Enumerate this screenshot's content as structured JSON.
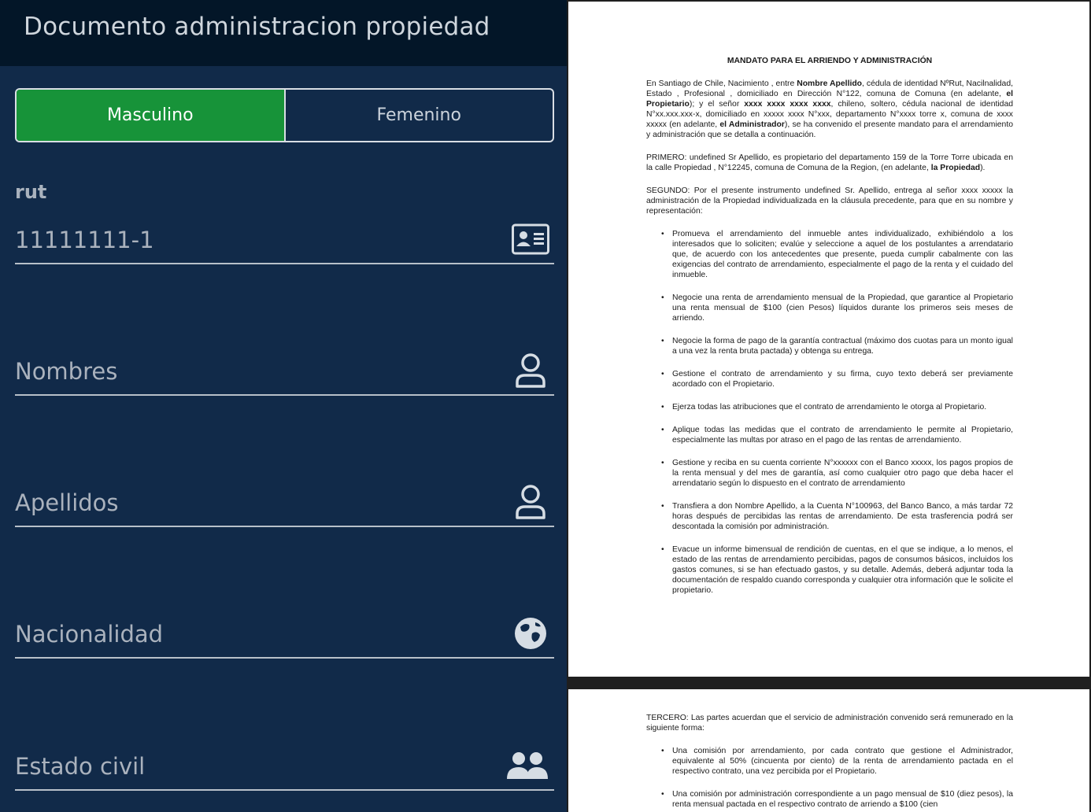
{
  "app": {
    "title": "Documento administracion propiedad"
  },
  "gender": {
    "male": "Masculino",
    "female": "Femenino",
    "selected": "Masculino"
  },
  "form": {
    "rut": {
      "label": "rut",
      "value": "11111111-1",
      "icon": "id-card-icon"
    },
    "nombres": {
      "placeholder": "Nombres",
      "icon": "user-icon"
    },
    "apellidos": {
      "placeholder": "Apellidos",
      "icon": "user-icon"
    },
    "nacionalidad": {
      "placeholder": "Nacionalidad",
      "icon": "globe-icon"
    },
    "estado_civil": {
      "placeholder": "Estado civil",
      "icon": "users-icon"
    }
  },
  "colors": {
    "panel": "#112a49",
    "appbar": "#031628",
    "selected": "#179339"
  },
  "document": {
    "title": "MANDATO PARA EL ARRIENDO Y ADMINISTRACIÓN",
    "intro": {
      "a": "En Santiago de Chile, Nacimiento , entre ",
      "b": "Nombre Apellido",
      "c": ", cédula de identidad NºRut, Nacilnalidad, Estado , Profesional , domiciliado en Dirección N°122, comuna de Comuna (en adelante, ",
      "d": "el Propietario",
      "e": "); y el señor ",
      "f": "xxxx xxxx xxxx xxxx",
      "g": ", chileno, soltero, cédula nacional de identidad N°xx.xxx.xxx-x, domiciliado en xxxxx xxxx N°xxx, departamento N°xxxx torre x, comuna de xxxx xxxxx (en adelante, ",
      "h": "el Administrador",
      "i": "), se ha convenido el presente mandato para el arrendamiento y administración que se detalla a continuación."
    },
    "primero": {
      "a": "PRIMERO: undefined Sr Apellido, es propietario del departamento 159 de la Torre Torre ubicada en la calle Propiedad , N°12245, comuna de Comuna de la Region, (en adelante, ",
      "b": "la Propiedad",
      "c": ")."
    },
    "segundo": "SEGUNDO: Por el presente instrumento undefined Sr. Apellido, entrega al señor xxxx xxxxx la administración de la Propiedad individualizada en la cláusula precedente, para que en su nombre y representación:",
    "bullets": [
      "Promueva el arrendamiento del inmueble antes individualizado, exhibiéndolo a los interesados que lo soliciten; evalúe y seleccione a aquel de los postulantes a arrendatario que, de acuerdo con los antecedentes que presente, pueda cumplir cabalmente con las exigencias del contrato de arrendamiento, especialmente el pago de la renta y el cuidado del inmueble.",
      "Negocie una renta de arrendamiento mensual de la Propiedad, que garantice al Propietario una renta mensual de $100 (cien Pesos) líquidos durante los primeros seis meses de arriendo.",
      "Negocie la forma de pago de la garantía contractual (máximo dos cuotas para un monto igual a una vez la renta bruta pactada) y obtenga su entrega.",
      "Gestione el contrato de arrendamiento y su firma, cuyo texto deberá ser previamente acordado con el Propietario.",
      "Ejerza todas las atribuciones que el contrato de arrendamiento le otorga al Propietario.",
      "Aplique todas las medidas que el contrato de arrendamiento le permite al Propietario, especialmente las multas por atraso en el pago de las rentas de arrendamiento.",
      "Gestione y reciba en su cuenta corriente N°xxxxxx con el Banco xxxxx, los pagos propios de la renta mensual y del mes de garantía, así como cualquier otro pago que deba hacer el arrendatario según lo dispuesto en el contrato de arrendamiento",
      "Transfiera a don Nombre Apellido, a la Cuenta N°100963, del Banco Banco, a más tardar 72 horas después de percibidas las rentas de arrendamiento. De esta trasferencia podrá ser descontada la comisión por administración.",
      "Evacue un informe bimensual de rendición de cuentas, en el que se indique, a lo menos, el estado de las rentas de arrendamiento percibidas, pagos de consumos básicos, incluidos los gastos comunes, si se han efectuado gastos, y su detalle. Además, deberá adjuntar toda la documentación de respaldo cuando corresponda y cualquier otra información que le solicite el propietario."
    ],
    "tercero": "TERCERO: Las partes acuerdan que el servicio de administración convenido será remunerado en la siguiente forma:",
    "tercero_bullets": [
      "Una comisión por arrendamiento, por cada contrato que gestione el Administrador, equivalente al 50% (cincuenta por ciento) de la renta de arrendamiento pactada en el respectivo contrato, una vez percibida por el Propietario.",
      "Una comisión por administración correspondiente a un pago mensual de $10 (diez pesos), la renta mensual pactada en el respectivo contrato de arriendo a $100 (cien"
    ]
  }
}
